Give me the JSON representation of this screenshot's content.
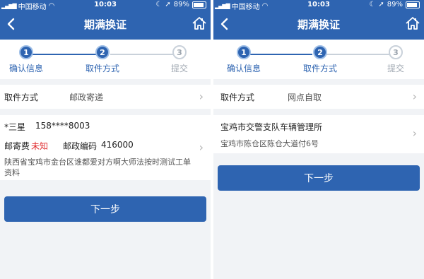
{
  "status": {
    "carrier": "中国移动",
    "time": "10:03",
    "battery": "89%"
  },
  "nav": {
    "title": "期满换证"
  },
  "steps": [
    {
      "num": "1",
      "label": "确认信息"
    },
    {
      "num": "2",
      "label": "取件方式"
    },
    {
      "num": "3",
      "label": "提交"
    }
  ],
  "left": {
    "method_label": "取件方式",
    "method_value": "邮政寄递",
    "recipient_name": "*三星",
    "recipient_phone": "158****8003",
    "postage_label": "邮寄费",
    "postage_value": "未知",
    "postcode_label": "邮政编码",
    "postcode_value": "416000",
    "address": "陕西省宝鸡市金台区谁都爱对方啊大师法按时测试工单资料",
    "next_button": "下一步"
  },
  "right": {
    "method_label": "取件方式",
    "method_value": "网点自取",
    "office_name": "宝鸡市交警支队车辆管理所",
    "office_address": "宝鸡市陈仓区陈仓大道付6号",
    "next_button": "下一步"
  },
  "colors": {
    "primary": "#2e64b1",
    "accent_red": "#e0292c",
    "background": "#f1f3f6"
  }
}
